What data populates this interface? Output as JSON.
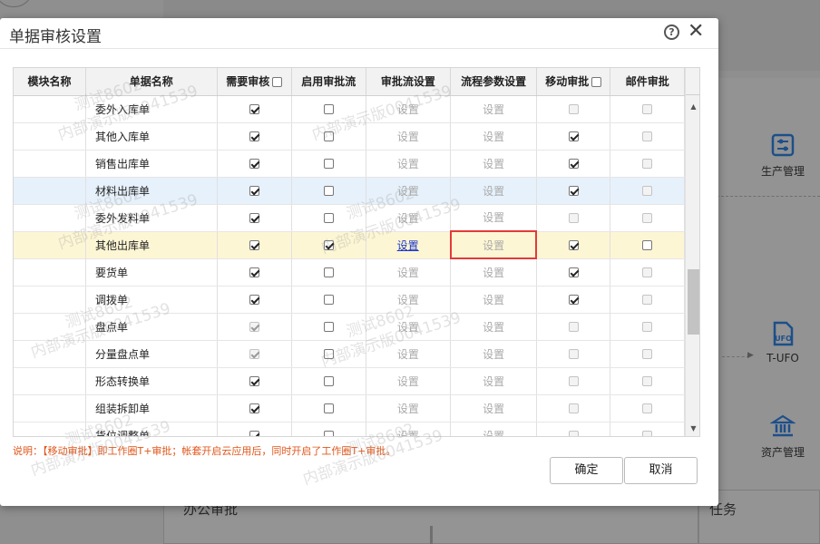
{
  "background": {
    "tiles": [
      {
        "label": "生产管理",
        "icon": "production-management-icon"
      },
      {
        "label": "T-UFO",
        "icon": "t-ufo-icon",
        "icon_text": "UFO"
      },
      {
        "label": "资产管理",
        "icon": "asset-management-icon"
      }
    ],
    "bottom_left_label": "办公审批",
    "bottom_right_label": "任务"
  },
  "dialog": {
    "title": "单据审核设置",
    "help_icon": "?",
    "close_icon": "✕",
    "columns": [
      "模块名称",
      "单据名称",
      "需要审核",
      "启用审批流",
      "审批流设置",
      "流程参数设置",
      "移动审批",
      "邮件审批"
    ],
    "rows": [
      {
        "module": "",
        "doc": "委外入库单",
        "need_audit": true,
        "need_audit_disabled": false,
        "approval_flow": false,
        "flow_setting": "设置",
        "flow_link": false,
        "param_setting": "设置",
        "mobile": false,
        "mobile_disabled": true,
        "email": false,
        "style": ""
      },
      {
        "module": "",
        "doc": "其他入库单",
        "need_audit": true,
        "need_audit_disabled": false,
        "approval_flow": false,
        "flow_setting": "设置",
        "flow_link": false,
        "param_setting": "设置",
        "mobile": true,
        "mobile_disabled": false,
        "email": false,
        "style": ""
      },
      {
        "module": "",
        "doc": "销售出库单",
        "need_audit": true,
        "need_audit_disabled": false,
        "approval_flow": false,
        "flow_setting": "设置",
        "flow_link": false,
        "param_setting": "设置",
        "mobile": true,
        "mobile_disabled": false,
        "email": false,
        "style": ""
      },
      {
        "module": "",
        "doc": "材料出库单",
        "need_audit": true,
        "need_audit_disabled": false,
        "approval_flow": false,
        "flow_setting": "设置",
        "flow_link": false,
        "param_setting": "设置",
        "mobile": true,
        "mobile_disabled": false,
        "email": false,
        "style": "blue"
      },
      {
        "module": "",
        "doc": "委外发料单",
        "need_audit": true,
        "need_audit_disabled": false,
        "approval_flow": false,
        "flow_setting": "设置",
        "flow_link": false,
        "param_setting": "设置",
        "mobile": false,
        "mobile_disabled": true,
        "email": false,
        "style": ""
      },
      {
        "module": "",
        "doc": "其他出库单",
        "need_audit": true,
        "need_audit_disabled": false,
        "approval_flow": true,
        "flow_setting": "设置",
        "flow_link": true,
        "param_setting": "设置",
        "mobile": true,
        "mobile_disabled": false,
        "email": false,
        "email_enabled": true,
        "style": "yellow",
        "highlight_param": true
      },
      {
        "module": "",
        "doc": "要货单",
        "need_audit": true,
        "need_audit_disabled": false,
        "approval_flow": false,
        "flow_setting": "设置",
        "flow_link": false,
        "param_setting": "设置",
        "mobile": true,
        "mobile_disabled": false,
        "email": false,
        "style": ""
      },
      {
        "module": "",
        "doc": "调拨单",
        "need_audit": true,
        "need_audit_disabled": false,
        "approval_flow": false,
        "flow_setting": "设置",
        "flow_link": false,
        "param_setting": "设置",
        "mobile": true,
        "mobile_disabled": false,
        "email": false,
        "style": ""
      },
      {
        "module": "",
        "doc": "盘点单",
        "need_audit": true,
        "need_audit_disabled": true,
        "approval_flow": false,
        "flow_setting": "设置",
        "flow_link": false,
        "param_setting": "设置",
        "mobile": false,
        "mobile_disabled": true,
        "email": false,
        "style": ""
      },
      {
        "module": "",
        "doc": "分量盘点单",
        "need_audit": true,
        "need_audit_disabled": true,
        "approval_flow": false,
        "flow_setting": "设置",
        "flow_link": false,
        "param_setting": "设置",
        "mobile": false,
        "mobile_disabled": true,
        "email": false,
        "style": ""
      },
      {
        "module": "",
        "doc": "形态转换单",
        "need_audit": true,
        "need_audit_disabled": false,
        "approval_flow": false,
        "flow_setting": "设置",
        "flow_link": false,
        "param_setting": "设置",
        "mobile": false,
        "mobile_disabled": true,
        "email": false,
        "style": ""
      },
      {
        "module": "",
        "doc": "组装拆卸单",
        "need_audit": true,
        "need_audit_disabled": false,
        "approval_flow": false,
        "flow_setting": "设置",
        "flow_link": false,
        "param_setting": "设置",
        "mobile": false,
        "mobile_disabled": true,
        "email": false,
        "style": ""
      },
      {
        "module": "",
        "doc": "货位调整单",
        "need_audit": true,
        "need_audit_disabled": false,
        "approval_flow": false,
        "flow_setting": "设置",
        "flow_link": false,
        "param_setting": "设置",
        "mobile": false,
        "mobile_disabled": true,
        "email": false,
        "style": ""
      }
    ],
    "note": "说明：【移动审批】即工作圈T+审批；帐套开启云应用后，同时开启了工作圈T+审批。",
    "ok_label": "确定",
    "cancel_label": "取消",
    "watermarks": [
      "测试8602",
      "内部演示版0041539"
    ]
  },
  "colors": {
    "note": "#e1561a",
    "link": "#1a35c8",
    "highlight_border": "#e23a3a",
    "selected_row": "#fdf6d4",
    "hover_row": "#e6f1fb"
  }
}
